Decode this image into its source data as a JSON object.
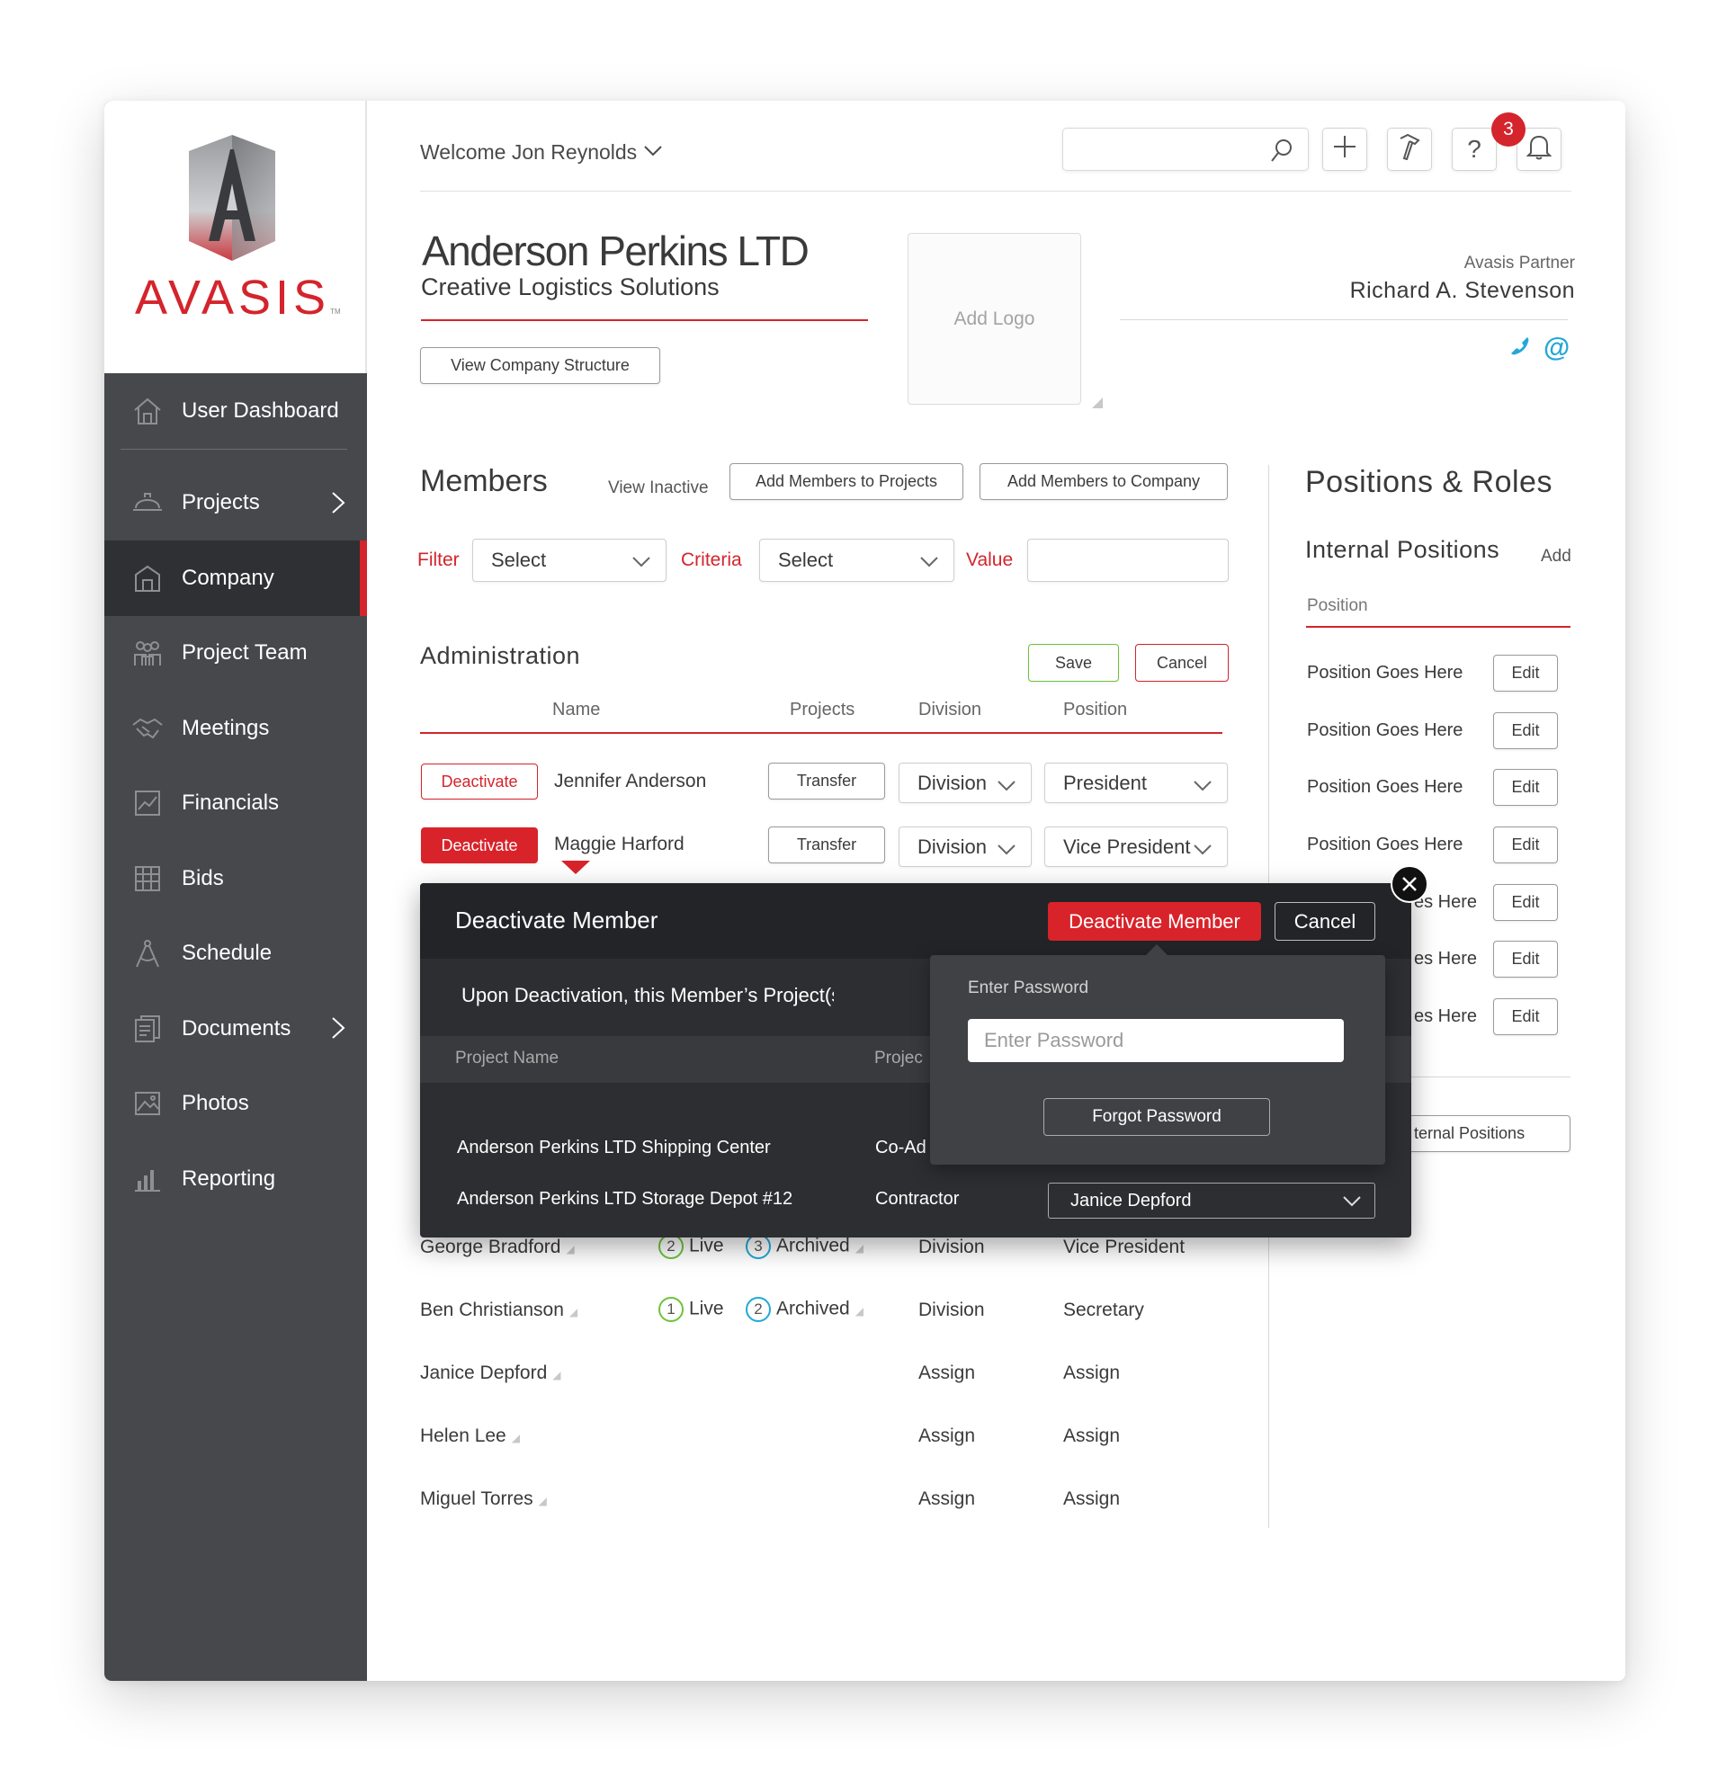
{
  "brand": {
    "name": "AVASIS",
    "tm": "TM"
  },
  "sidebar": {
    "items": [
      {
        "label": "User Dashboard",
        "icon": "home-icon"
      },
      {
        "label": "Projects",
        "icon": "hardhat-icon",
        "has_children": true
      },
      {
        "label": "Company",
        "icon": "building-icon",
        "active": true
      },
      {
        "label": "Project Team",
        "icon": "team-icon"
      },
      {
        "label": "Meetings",
        "icon": "handshake-icon"
      },
      {
        "label": "Financials",
        "icon": "chart-icon"
      },
      {
        "label": "Bids",
        "icon": "grid-icon"
      },
      {
        "label": "Schedule",
        "icon": "compass-icon"
      },
      {
        "label": "Documents",
        "icon": "documents-icon",
        "has_children": true
      },
      {
        "label": "Photos",
        "icon": "photo-icon"
      },
      {
        "label": "Reporting",
        "icon": "bar-chart-icon"
      }
    ]
  },
  "header": {
    "welcome": "Welcome Jon Reynolds",
    "search_placeholder": "",
    "notification_count": "3",
    "tool_icons": [
      "plus-icon",
      "hammer-icon",
      "help-icon",
      "bell-icon"
    ],
    "help_glyph": "?"
  },
  "company": {
    "name": "Anderson Perkins LTD",
    "tagline": "Creative Logistics Solutions",
    "structure_button": "View Company Structure",
    "logo_placeholder": "Add Logo",
    "partner_label": "Avasis Partner",
    "partner_name": "Richard A. Stevenson",
    "contact_icons": [
      "phone-icon",
      "email-icon"
    ],
    "email_glyph": "@"
  },
  "members": {
    "title": "Members",
    "view_inactive": "View Inactive",
    "add_to_projects": "Add Members to Projects",
    "add_to_company": "Add Members to Company",
    "filter_label": "Filter",
    "filter_value": "Select",
    "criteria_label": "Criteria",
    "criteria_value": "Select",
    "value_label": "Value",
    "value_input": ""
  },
  "administration": {
    "title": "Administration",
    "save": "Save",
    "cancel": "Cancel",
    "columns": {
      "name": "Name",
      "projects": "Projects",
      "division": "Division",
      "position": "Position"
    },
    "rows": [
      {
        "action": "Deactivate",
        "name": "Jennifer Anderson",
        "transfer": "Transfer",
        "division": "Division",
        "position": "President"
      },
      {
        "action": "Deactivate",
        "name": "Maggie Harford",
        "transfer": "Transfer",
        "division": "Division",
        "position": "Vice President"
      }
    ]
  },
  "members_list": [
    {
      "name": "George Bradford",
      "live": "2",
      "live_label": "Live",
      "archived": "3",
      "archived_label": "Archived",
      "division": "Division",
      "position": "Vice President"
    },
    {
      "name": "Ben Christianson",
      "live": "1",
      "live_label": "Live",
      "archived": "2",
      "archived_label": "Archived",
      "division": "Division",
      "position": "Secretary"
    },
    {
      "name": "Janice Depford",
      "division": "Assign",
      "position": "Assign"
    },
    {
      "name": "Helen Lee",
      "division": "Assign",
      "position": "Assign"
    },
    {
      "name": "Miguel Torres",
      "division": "Assign",
      "position": "Assign"
    }
  ],
  "positions": {
    "title": "Positions & Roles",
    "internal_title": "Internal Positions",
    "add": "Add",
    "column": "Position",
    "edit_label": "Edit",
    "items": [
      "Position Goes Here",
      "Position Goes Here",
      "Position Goes Here",
      "Position Goes Here",
      "es Here",
      "es Here",
      "es Here"
    ],
    "footer_button": "ternal Positions"
  },
  "modal": {
    "title": "Deactivate Member",
    "confirm": "Deactivate Member",
    "cancel": "Cancel",
    "message": "Upon Deactivation, this Member’s Project(s) and Rol",
    "columns": {
      "project_name": "Project Name",
      "project_role": "Projec"
    },
    "rows": [
      {
        "project": "Anderson Perkins LTD Shipping Center",
        "role": "Co-Ad"
      },
      {
        "project": "Anderson Perkins LTD Storage Depot #12",
        "role": "Contractor",
        "reassign": "Janice Depford"
      }
    ]
  },
  "password_popover": {
    "label": "Enter Password",
    "placeholder": "Enter Password",
    "forgot": "Forgot Password"
  },
  "colors": {
    "accent_red": "#d4242c",
    "sidebar_bg": "#46484c",
    "live_green": "#6cc43c",
    "archived_blue": "#22a8d8",
    "modal_bg": "#2d2e31"
  }
}
